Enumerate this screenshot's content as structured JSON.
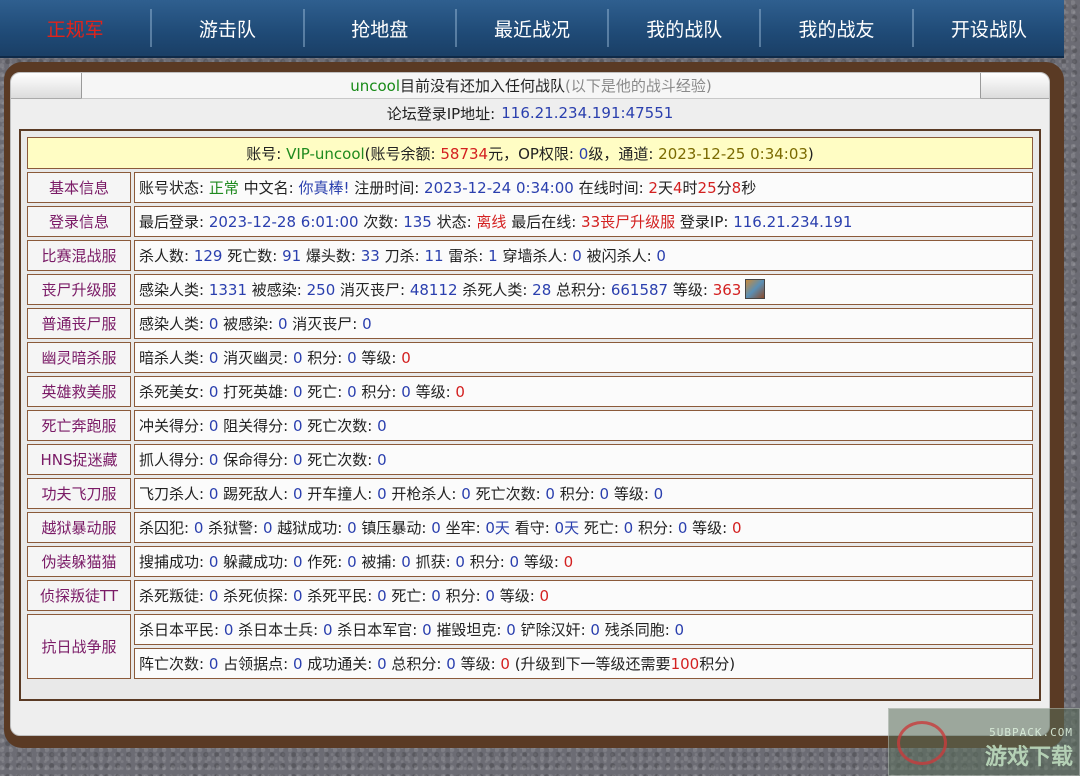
{
  "nav": [
    "正规军",
    "游击队",
    "抢地盘",
    "最近战况",
    "我的战队",
    "我的战友",
    "开设战队"
  ],
  "header": {
    "user": "uncool",
    "status_text": "目前没有还加入任何战队",
    "note": "(以下是他的战斗经验)"
  },
  "ip_line": {
    "label": "论坛登录IP地址:",
    "value": "116.21.234.191:47551"
  },
  "account": {
    "prefix": "账号:",
    "id": "VIP-uncool",
    "balance_label": "(账号余额:",
    "balance": "58734",
    "balance_unit": "元，OP权限:",
    "op_level": "0",
    "op_unit": "级，通道:",
    "channel_date": "2023-12-25 0:34:03",
    "suffix": ")"
  },
  "rows": [
    {
      "label": "基本信息",
      "parts": [
        {
          "t": "账号状态: "
        },
        {
          "t": "正常",
          "c": "darkgreen"
        },
        {
          "t": " 中文名: "
        },
        {
          "t": "你真棒!",
          "c": "blue"
        },
        {
          "t": " 注册时间: "
        },
        {
          "t": "2023-12-24 0:34:00",
          "c": "blue"
        },
        {
          "t": " 在线时间: "
        },
        {
          "t": "2",
          "c": "red"
        },
        {
          "t": "天"
        },
        {
          "t": "4",
          "c": "red"
        },
        {
          "t": "时"
        },
        {
          "t": "25",
          "c": "red"
        },
        {
          "t": "分"
        },
        {
          "t": "8",
          "c": "red"
        },
        {
          "t": "秒"
        }
      ]
    },
    {
      "label": "登录信息",
      "parts": [
        {
          "t": "最后登录: "
        },
        {
          "t": "2023-12-28 6:01:00",
          "c": "blue"
        },
        {
          "t": " 次数: "
        },
        {
          "t": "135",
          "c": "blue"
        },
        {
          "t": " 状态: "
        },
        {
          "t": "离线",
          "c": "red"
        },
        {
          "t": " 最后在线: "
        },
        {
          "t": "33丧尸升级服",
          "c": "red"
        },
        {
          "t": " 登录IP: "
        },
        {
          "t": "116.21.234.191",
          "c": "blue"
        }
      ]
    },
    {
      "label": "比赛混战服",
      "parts": [
        {
          "t": "杀人数: "
        },
        {
          "t": "129",
          "c": "blue"
        },
        {
          "t": " 死亡数: "
        },
        {
          "t": "91",
          "c": "blue"
        },
        {
          "t": " 爆头数: "
        },
        {
          "t": "33",
          "c": "blue"
        },
        {
          "t": " 刀杀: "
        },
        {
          "t": "11",
          "c": "blue"
        },
        {
          "t": " 雷杀: "
        },
        {
          "t": "1",
          "c": "blue"
        },
        {
          "t": " 穿墙杀人: "
        },
        {
          "t": "0",
          "c": "blue"
        },
        {
          "t": " 被闪杀人: "
        },
        {
          "t": "0",
          "c": "blue"
        }
      ]
    },
    {
      "label": "丧尸升级服",
      "avatar": true,
      "parts": [
        {
          "t": "感染人类: "
        },
        {
          "t": "1331",
          "c": "blue"
        },
        {
          "t": " 被感染: "
        },
        {
          "t": "250",
          "c": "blue"
        },
        {
          "t": " 消灭丧尸: "
        },
        {
          "t": "48112",
          "c": "blue"
        },
        {
          "t": " 杀死人类: "
        },
        {
          "t": "28",
          "c": "blue"
        },
        {
          "t": " 总积分: "
        },
        {
          "t": "661587",
          "c": "blue"
        },
        {
          "t": " 等级: "
        },
        {
          "t": "363",
          "c": "red"
        }
      ]
    },
    {
      "label": "普通丧尸服",
      "parts": [
        {
          "t": "感染人类: "
        },
        {
          "t": "0",
          "c": "blue"
        },
        {
          "t": " 被感染: "
        },
        {
          "t": "0",
          "c": "blue"
        },
        {
          "t": " 消灭丧尸: "
        },
        {
          "t": "0",
          "c": "blue"
        }
      ]
    },
    {
      "label": "幽灵暗杀服",
      "parts": [
        {
          "t": "暗杀人类: "
        },
        {
          "t": "0",
          "c": "blue"
        },
        {
          "t": " 消灭幽灵: "
        },
        {
          "t": "0",
          "c": "blue"
        },
        {
          "t": " 积分: "
        },
        {
          "t": "0",
          "c": "blue"
        },
        {
          "t": " 等级: "
        },
        {
          "t": "0",
          "c": "red"
        }
      ]
    },
    {
      "label": "英雄救美服",
      "parts": [
        {
          "t": "杀死美女: "
        },
        {
          "t": "0",
          "c": "blue"
        },
        {
          "t": " 打死英雄: "
        },
        {
          "t": "0",
          "c": "blue"
        },
        {
          "t": " 死亡: "
        },
        {
          "t": "0",
          "c": "blue"
        },
        {
          "t": " 积分: "
        },
        {
          "t": "0",
          "c": "blue"
        },
        {
          "t": " 等级: "
        },
        {
          "t": "0",
          "c": "red"
        }
      ]
    },
    {
      "label": "死亡奔跑服",
      "parts": [
        {
          "t": "冲关得分: "
        },
        {
          "t": "0",
          "c": "blue"
        },
        {
          "t": " 阻关得分: "
        },
        {
          "t": "0",
          "c": "blue"
        },
        {
          "t": " 死亡次数: "
        },
        {
          "t": "0",
          "c": "blue"
        }
      ]
    },
    {
      "label": "HNS捉迷藏",
      "parts": [
        {
          "t": "抓人得分: "
        },
        {
          "t": "0",
          "c": "blue"
        },
        {
          "t": " 保命得分: "
        },
        {
          "t": "0",
          "c": "blue"
        },
        {
          "t": " 死亡次数: "
        },
        {
          "t": "0",
          "c": "blue"
        }
      ]
    },
    {
      "label": "功夫飞刀服",
      "parts": [
        {
          "t": "飞刀杀人: "
        },
        {
          "t": "0",
          "c": "blue"
        },
        {
          "t": " 踢死敌人: "
        },
        {
          "t": "0",
          "c": "blue"
        },
        {
          "t": " 开车撞人: "
        },
        {
          "t": "0",
          "c": "blue"
        },
        {
          "t": " 开枪杀人: "
        },
        {
          "t": "0",
          "c": "blue"
        },
        {
          "t": " 死亡次数: "
        },
        {
          "t": "0",
          "c": "blue"
        },
        {
          "t": " 积分: "
        },
        {
          "t": "0",
          "c": "blue"
        },
        {
          "t": " 等级: "
        },
        {
          "t": "0",
          "c": "blue"
        }
      ]
    },
    {
      "label": "越狱暴动服",
      "parts": [
        {
          "t": "杀囚犯: "
        },
        {
          "t": "0",
          "c": "blue"
        },
        {
          "t": " 杀狱警: "
        },
        {
          "t": "0",
          "c": "blue"
        },
        {
          "t": " 越狱成功: "
        },
        {
          "t": "0",
          "c": "blue"
        },
        {
          "t": " 镇压暴动: "
        },
        {
          "t": "0",
          "c": "blue"
        },
        {
          "t": " 坐牢: "
        },
        {
          "t": "0天",
          "c": "blue"
        },
        {
          "t": " 看守: "
        },
        {
          "t": "0天",
          "c": "blue"
        },
        {
          "t": " 死亡: "
        },
        {
          "t": "0",
          "c": "blue"
        },
        {
          "t": " 积分: "
        },
        {
          "t": "0",
          "c": "blue"
        },
        {
          "t": " 等级: "
        },
        {
          "t": "0",
          "c": "red"
        }
      ]
    },
    {
      "label": "伪装躲猫猫",
      "parts": [
        {
          "t": "搜捕成功: "
        },
        {
          "t": "0",
          "c": "blue"
        },
        {
          "t": " 躲藏成功: "
        },
        {
          "t": "0",
          "c": "blue"
        },
        {
          "t": " 作死: "
        },
        {
          "t": "0",
          "c": "blue"
        },
        {
          "t": " 被捕: "
        },
        {
          "t": "0",
          "c": "blue"
        },
        {
          "t": " 抓获: "
        },
        {
          "t": "0",
          "c": "blue"
        },
        {
          "t": " 积分: "
        },
        {
          "t": "0",
          "c": "blue"
        },
        {
          "t": " 等级: "
        },
        {
          "t": "0",
          "c": "red"
        }
      ]
    },
    {
      "label": "侦探叛徒TT",
      "parts": [
        {
          "t": "杀死叛徒: "
        },
        {
          "t": "0",
          "c": "blue"
        },
        {
          "t": " 杀死侦探: "
        },
        {
          "t": "0",
          "c": "blue"
        },
        {
          "t": " 杀死平民: "
        },
        {
          "t": "0",
          "c": "blue"
        },
        {
          "t": " 死亡: "
        },
        {
          "t": "0",
          "c": "blue"
        },
        {
          "t": " 积分: "
        },
        {
          "t": "0",
          "c": "blue"
        },
        {
          "t": " 等级: "
        },
        {
          "t": "0",
          "c": "red"
        }
      ]
    }
  ],
  "last_group": {
    "label": "抗日战争服",
    "line1": [
      {
        "t": "杀日本平民: "
      },
      {
        "t": "0",
        "c": "blue"
      },
      {
        "t": " 杀日本士兵: "
      },
      {
        "t": "0",
        "c": "blue"
      },
      {
        "t": " 杀日本军官: "
      },
      {
        "t": "0",
        "c": "blue"
      },
      {
        "t": " 摧毁坦克: "
      },
      {
        "t": "0",
        "c": "blue"
      },
      {
        "t": " 铲除汉奸: "
      },
      {
        "t": "0",
        "c": "blue"
      },
      {
        "t": " 残杀同胞: "
      },
      {
        "t": "0",
        "c": "blue"
      }
    ],
    "line2": [
      {
        "t": "阵亡次数: "
      },
      {
        "t": "0",
        "c": "blue"
      },
      {
        "t": " 占领据点: "
      },
      {
        "t": "0",
        "c": "blue"
      },
      {
        "t": " 成功通关: "
      },
      {
        "t": "0",
        "c": "blue"
      },
      {
        "t": " 总积分: "
      },
      {
        "t": "0",
        "c": "blue"
      },
      {
        "t": " 等级: "
      },
      {
        "t": "0",
        "c": "red"
      },
      {
        "t": " (升级到下一等级还需要"
      },
      {
        "t": "100",
        "c": "red"
      },
      {
        "t": "积分)"
      }
    ]
  },
  "watermark": {
    "top": "5UBPACK.COM",
    "bottom": "游戏下载"
  }
}
